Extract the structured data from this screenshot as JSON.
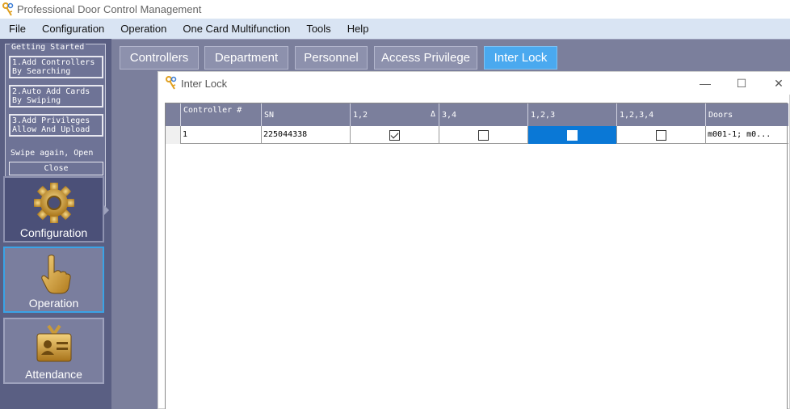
{
  "app": {
    "title": "Professional Door Control Management"
  },
  "menu": [
    "File",
    "Configuration",
    "Operation",
    "One Card Multifunction",
    "Tools",
    "Help"
  ],
  "getting_started": {
    "legend": "Getting Started",
    "items": [
      "1.Add Controllers\nBy Searching",
      "2.Auto Add Cards\nBy Swiping",
      "3.Add Privileges\nAllow And Upload"
    ],
    "note": "Swipe again, Open",
    "close": "Close"
  },
  "nav": [
    {
      "label": "Configuration",
      "icon": "gear-icon",
      "state": "active"
    },
    {
      "label": "Operation",
      "icon": "hand-pointer-icon",
      "state": "hover"
    },
    {
      "label": "Attendance",
      "icon": "id-card-icon",
      "state": "normal"
    }
  ],
  "tabs": [
    "Controllers",
    "Department",
    "Personnel",
    "Access Privilege",
    "Inter Lock"
  ],
  "active_tab": "Inter Lock",
  "window": {
    "title": "Inter Lock",
    "minimize": "—",
    "maximize": "☐",
    "close": "✕"
  },
  "grid": {
    "columns": [
      "Controller #",
      "SN",
      "1,2",
      "3,4",
      "1,2,3",
      "1,2,3,4",
      "Doors"
    ],
    "sort_indicator": "Δ",
    "rows": [
      {
        "controller": "1",
        "sn": "225044338",
        "c12": true,
        "c34": false,
        "c123": false,
        "c1234": false,
        "doors": "m001-1;   m0..."
      }
    ]
  },
  "colors": {
    "accent": "#4aa9ef",
    "selection": "#0a78d6",
    "panel": "#5a5f83"
  }
}
